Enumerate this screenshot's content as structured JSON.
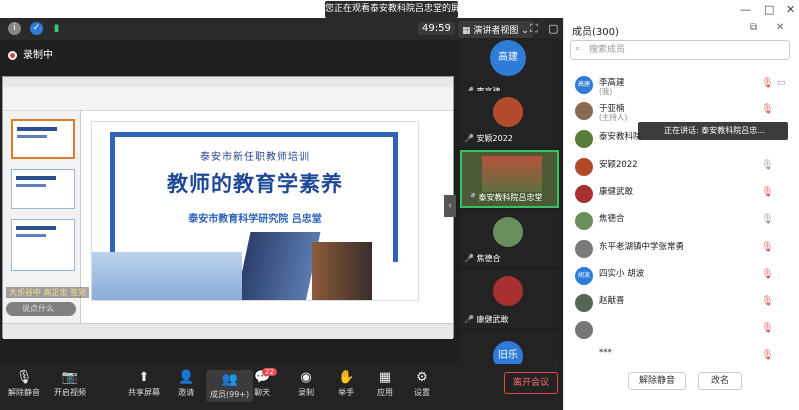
{
  "top": {
    "banner": "您正在观看泰安教科院吕忠堂的屏幕",
    "win_min": "—",
    "win_max": "□",
    "win_close": "✕"
  },
  "meeting_bar": {
    "timer": "49:59",
    "view_label": "演讲者视图",
    "recording": "录制中"
  },
  "slide": {
    "subtitle": "泰安市新任职教师培训",
    "title": "教师的教育学素养",
    "author": "泰安市教育科学研究院 吕忠堂"
  },
  "overlay": {
    "caption": "大乐谷中 高正忠 签到",
    "comment": "说点什么"
  },
  "videos": [
    {
      "name": "李高建",
      "avatar": "高建",
      "color": "#2f7bd8"
    },
    {
      "name": "安颖2022",
      "avatar": "",
      "color": "#b04a2a"
    },
    {
      "name": "泰安教科院吕忠堂",
      "avatar": "",
      "color": "#5a7a3a"
    },
    {
      "name": "焦德合",
      "avatar": "",
      "color": "#6b8f5c"
    },
    {
      "name": "康健武敢",
      "avatar": "",
      "color": "#a83030"
    },
    {
      "name": "",
      "avatar": "旧乐",
      "color": "#2f7bd8"
    }
  ],
  "toolbar": {
    "mute": "解除静音",
    "video": "开启视频",
    "share": "共享屏幕",
    "invite": "邀请",
    "members": "成员(99+)",
    "chat": "聊天",
    "chat_badge": "22",
    "record": "录制",
    "raise": "举手",
    "apps": "应用",
    "settings": "设置",
    "leave": "离开会议"
  },
  "panel": {
    "title": "成员(300)",
    "search_placeholder": "搜索成员",
    "tooltip": "正在讲话: 泰安教科院吕忠...",
    "members": [
      {
        "name": "李高建",
        "sub": "(我)",
        "avatar": "高建",
        "color": "#2f7bd8"
      },
      {
        "name": "于亚楠",
        "sub": "(主持人)",
        "avatar": "",
        "color": "#8a6a50"
      },
      {
        "name": "泰安教科院",
        "sub": "",
        "avatar": "",
        "color": "#5a7a3a"
      },
      {
        "name": "安颖2022",
        "sub": "",
        "avatar": "",
        "color": "#b04a2a"
      },
      {
        "name": "康健武敢",
        "sub": "",
        "avatar": "",
        "color": "#a83030"
      },
      {
        "name": "焦德合",
        "sub": "",
        "avatar": "",
        "color": "#6b8f5c"
      },
      {
        "name": "东平老湖镇中学张常勇",
        "sub": "",
        "avatar": "",
        "color": "#7a7a7a"
      },
      {
        "name": "四实小 胡波",
        "sub": "",
        "avatar": "胡波",
        "color": "#2f7bd8"
      },
      {
        "name": "赵献喜",
        "sub": "",
        "avatar": "",
        "color": "#556655"
      },
      {
        "name": "",
        "sub": "",
        "avatar": "",
        "color": "#777777"
      },
      {
        "name": "***",
        "sub": "",
        "avatar": "",
        "color": "#999999"
      }
    ],
    "unmute_all": "解除静音",
    "rename": "改名"
  }
}
